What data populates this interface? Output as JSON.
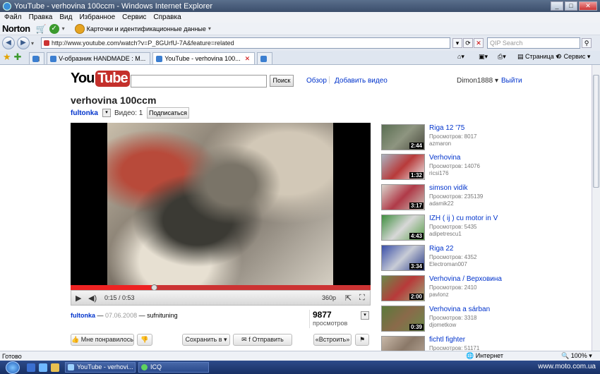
{
  "window": {
    "title": "YouTube - verhovina 100ccm - Windows Internet Explorer"
  },
  "menu": [
    "Файл",
    "Правка",
    "Вид",
    "Избранное",
    "Сервис",
    "Справка"
  ],
  "norton": {
    "logo": "Norton",
    "cards_label": "Карточки и идентификационные данные"
  },
  "address": {
    "url": "http://www.youtube.com/watch?v=P_8GUrfU-7A&feature=related",
    "search_placeholder": "QIP Search"
  },
  "tabs": [
    {
      "label": "V-образник HANDMADE : M..."
    },
    {
      "label": "YouTube - verhovina 100..."
    }
  ],
  "toolbar": {
    "page": "Страница",
    "service": "Сервис"
  },
  "youtube": {
    "logo_you": "You",
    "logo_tube": "Tube",
    "search_button": "Поиск",
    "links": [
      "Обзор",
      "Добавить видео"
    ],
    "user": "Dimon1888",
    "logout": "Выйти",
    "video_title": "verhovina 100ccm",
    "channel": "fultonka",
    "video_count": "Видео: 1",
    "subscribe": "Подписаться",
    "player": {
      "time": "0:15 / 0:53",
      "quality": "360p",
      "progress": 0.28
    },
    "info": {
      "channel": "fultonka",
      "date": "07.06.2008",
      "description": "sufnituning"
    },
    "views": {
      "count": "9877",
      "label": "просмотров"
    },
    "actions": {
      "like": "Мне понравилось",
      "save": "Сохранить в",
      "send": "Отправить",
      "embed": "«Встроить»"
    }
  },
  "related": [
    {
      "title": "Riga 12 '75",
      "views": "Просмотров: 8017",
      "author": "azmaron",
      "duration": "2:44"
    },
    {
      "title": "Verhovina",
      "views": "Просмотров: 14076",
      "author": "ricsi176",
      "duration": "1:32"
    },
    {
      "title": "simson vidik",
      "views": "Просмотров: 235139",
      "author": "adamik22",
      "duration": "3:17"
    },
    {
      "title": "IZH ( ij ) cu motor in V",
      "views": "Просмотров: 5435",
      "author": "adipetrescu1",
      "duration": "4:43"
    },
    {
      "title": "Riga 22",
      "views": "Просмотров: 4352",
      "author": "Electroman007",
      "duration": "3:34"
    },
    {
      "title": "Verhovina / Верховина",
      "views": "Просмотров: 2410",
      "author": "pavlonz",
      "duration": "2:00"
    },
    {
      "title": "Verhovina a sárban",
      "views": "Просмотров: 3318",
      "author": "djometkow",
      "duration": "0:39"
    },
    {
      "title": "fichtl fighter",
      "views": "Просмотров: 51171",
      "author": "",
      "duration": ""
    }
  ],
  "status": {
    "text": "Готово",
    "zone": "Интернет",
    "zoom": "100%"
  },
  "taskbar": {
    "items": [
      "YouTube - verhovi...",
      "ICQ"
    ],
    "watermark": "www.moto.com.ua"
  }
}
